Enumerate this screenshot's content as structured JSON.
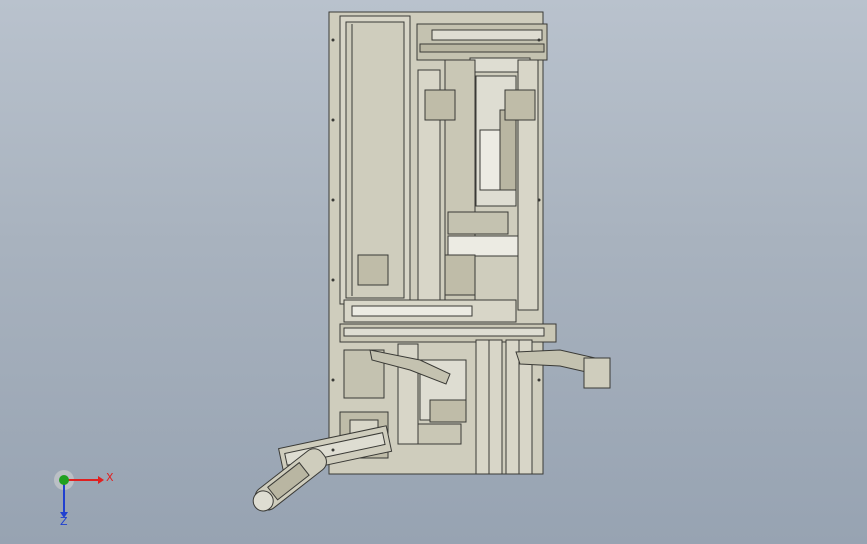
{
  "viewport": {
    "background_top": "#b9c2cd",
    "background_bottom": "#97a3b2",
    "part_fill": "#cfcdbd",
    "part_fill_dark": "#b9b6a2",
    "edge_color": "#3a3a36",
    "highlight": "#e9e8df"
  },
  "triad": {
    "x_label": "X",
    "z_label": "Z",
    "x_color": "#e02020",
    "y_color": "#20a020",
    "z_color": "#2040d0"
  }
}
